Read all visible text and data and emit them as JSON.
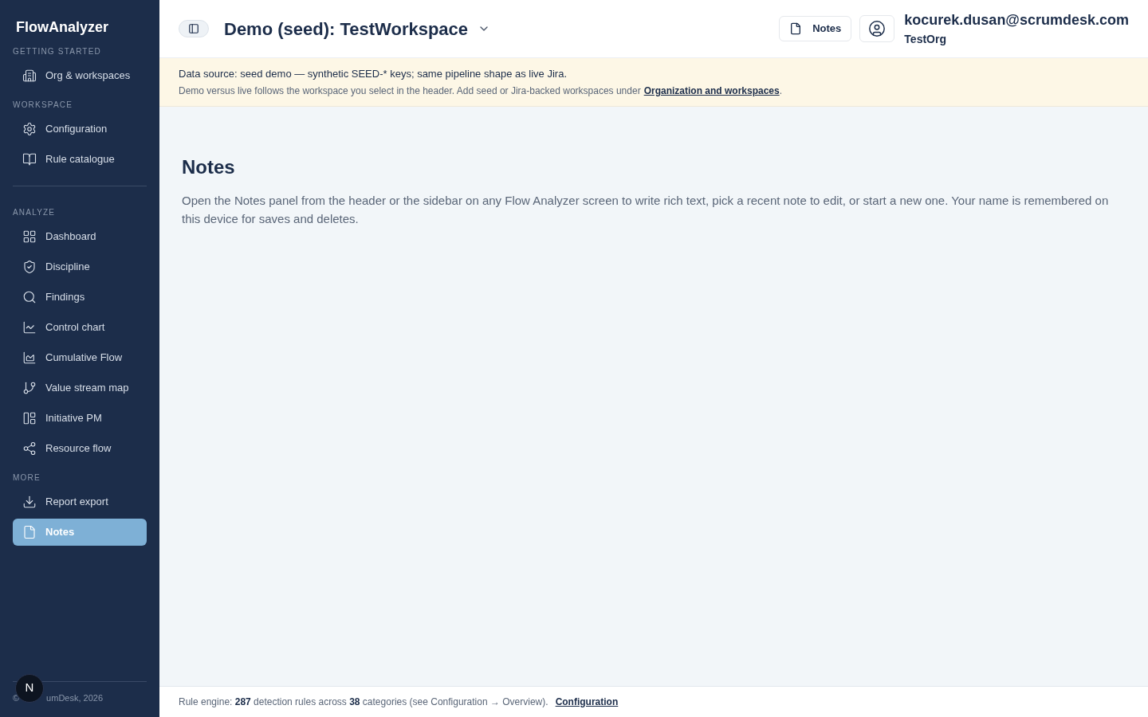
{
  "sidebar": {
    "brand": "FlowAnalyzer",
    "sections": [
      {
        "heading": "GETTING STARTED",
        "divider": false,
        "items": [
          {
            "label": "Org & workspaces",
            "selected": false
          }
        ]
      },
      {
        "heading": "WORKSPACE",
        "divider": false,
        "items": [
          {
            "label": "Configuration",
            "selected": false
          },
          {
            "label": "Rule catalogue",
            "selected": false
          }
        ]
      },
      {
        "heading": "ANALYZE",
        "divider": true,
        "items": [
          {
            "label": "Dashboard",
            "selected": false
          },
          {
            "label": "Discipline",
            "selected": false
          },
          {
            "label": "Findings",
            "selected": false
          },
          {
            "label": "Control chart",
            "selected": false
          },
          {
            "label": "Cumulative Flow",
            "selected": false
          },
          {
            "label": "Value stream map",
            "selected": false
          },
          {
            "label": "Initiative PM",
            "selected": false
          },
          {
            "label": "Resource flow",
            "selected": false
          }
        ]
      },
      {
        "heading": "MORE",
        "divider": false,
        "items": [
          {
            "label": "Report export",
            "selected": false
          },
          {
            "label": "Notes",
            "selected": true
          }
        ]
      }
    ],
    "footer_parts": [
      "©",
      "umDesk, 2026"
    ],
    "badge": "N"
  },
  "header": {
    "workspace": "Demo (seed): TestWorkspace",
    "notes_button": "Notes",
    "user_email": "kocurek.dusan@scrumdesk.com",
    "org": "TestOrg"
  },
  "banner": {
    "line1": "Data source: seed demo — synthetic SEED-* keys; same pipeline shape as live Jira.",
    "line2": "Demo versus live follows the workspace you select in the header. Add seed or Jira-backed workspaces under",
    "link": "Organization and workspaces",
    "after_link": "."
  },
  "main": {
    "title": "Notes",
    "description": "Open the Notes panel from the header or the sidebar on any Flow Analyzer screen to write rich text, pick a recent note to edit, or start a new one. Your name is remembered on this device for saves and deletes."
  },
  "status_bar": {
    "text": "Rule engine: **287** detection rules across **38** categories (see Configuration → Overview).",
    "link": "Configuration"
  }
}
